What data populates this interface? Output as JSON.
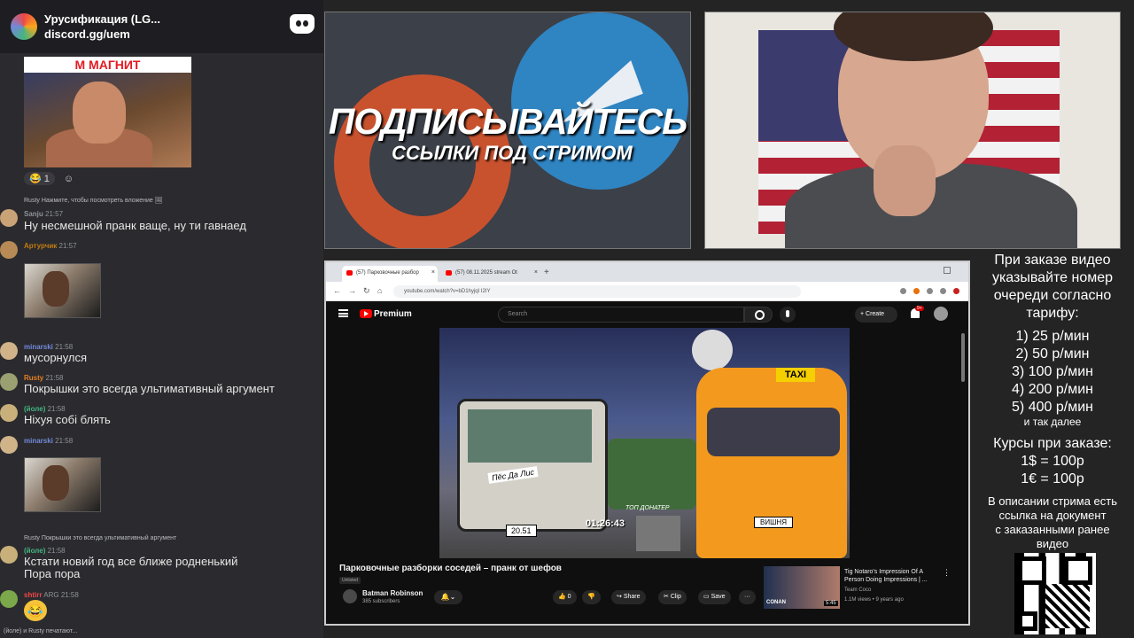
{
  "discord": {
    "server_name": "Урусификация (LG...",
    "invite": "discord.gg/uem",
    "gif_banner": "М МАГНИТ",
    "reactions": [
      {
        "emoji": "😂",
        "count": "1"
      },
      {
        "emoji": "☺",
        "count": ""
      }
    ],
    "messages": [
      {
        "reply": "Rusty Нажмите, чтобы посмотреть вложение 🖼",
        "user": "Sanju",
        "time": "21:57",
        "text": "Ну несмешной пранк ваще, ну ти гавнаед"
      },
      {
        "user": "Артурчик",
        "time": "21:57",
        "text": ""
      },
      {
        "user": "minarski",
        "time": "21:58",
        "text": "мусорнулся"
      },
      {
        "user": "Rusty",
        "time": "21:58",
        "text": "Покрышки это всегда ультимативный аргумент"
      },
      {
        "user": "(йоле)",
        "time": "21:58",
        "text": "Ніхуя собі блять"
      },
      {
        "user": "minarski",
        "time": "21:58",
        "text": ""
      },
      {
        "reply": "Rusty Покрышки это всегда ультимативный аргумент",
        "user": "(йоле)",
        "time": "21:58",
        "text": "Кстати новий год все ближе родненький",
        "text2": "Пора пора"
      },
      {
        "user": "shtirr",
        "badge": "ARG",
        "time": "21:58",
        "text": ""
      }
    ],
    "typing": "(йоле) и Rusty печатают..."
  },
  "promo": {
    "title": "ПОДПИСЫВАЙТЕСЬ",
    "subtitle": "ССЫЛКИ ПОД СТРИМОМ"
  },
  "browser": {
    "tabs": [
      {
        "label": "(57) Парковочные разбор",
        "active": true
      },
      {
        "label": "(57) 08.11.2025 stream Ot",
        "active": false
      }
    ],
    "url": "youtube.com/watch?v=bD1hyjqI I2IY"
  },
  "youtube": {
    "brand": "Premium",
    "search_placeholder": "Search",
    "create_label": "+ Create",
    "notif_count": "9+",
    "video": {
      "title": "Парковочные разборки соседей – пранк от шефов",
      "visibility": "Unlisted",
      "channel": "Batman Robinson",
      "subscribers": "385 subscribers",
      "timestamp": "01:26:43",
      "likes": "0",
      "share_label": "Share",
      "clip_label": "Clip",
      "save_label": "Save",
      "more_label": "···"
    },
    "scene": {
      "taxi": "TAXI",
      "pes_da_lis": "Пёс Да Лис",
      "plate_left": "20.51",
      "vishnya": "ВИШНЯ",
      "top_donator": "ТОП ДОНАТЕР"
    },
    "recommendation": {
      "title": "Tig Notaro's Impression Of A Person Doing Impressions | ...",
      "channel": "Team Coco",
      "meta": "1.1M views • 9 years ago",
      "thumb_label": "CONAN",
      "duration": "5:45"
    }
  },
  "info_panel": {
    "head": [
      "При заказе видео",
      "указывайте номер",
      "очереди согласно",
      "тарифу:"
    ],
    "rates": [
      "1) 25 р/мин",
      "2) 50 р/мин",
      "3) 100 р/мин",
      "4) 200 р/мин",
      "5) 400 р/мин"
    ],
    "etc": "и так далее",
    "courses": [
      "Курсы при заказе:",
      "1$ = 100р",
      "1€ = 100р"
    ],
    "desc": [
      "В описании стрима есть",
      "ссылка на документ",
      "с заказанными ранее",
      "видео"
    ]
  }
}
